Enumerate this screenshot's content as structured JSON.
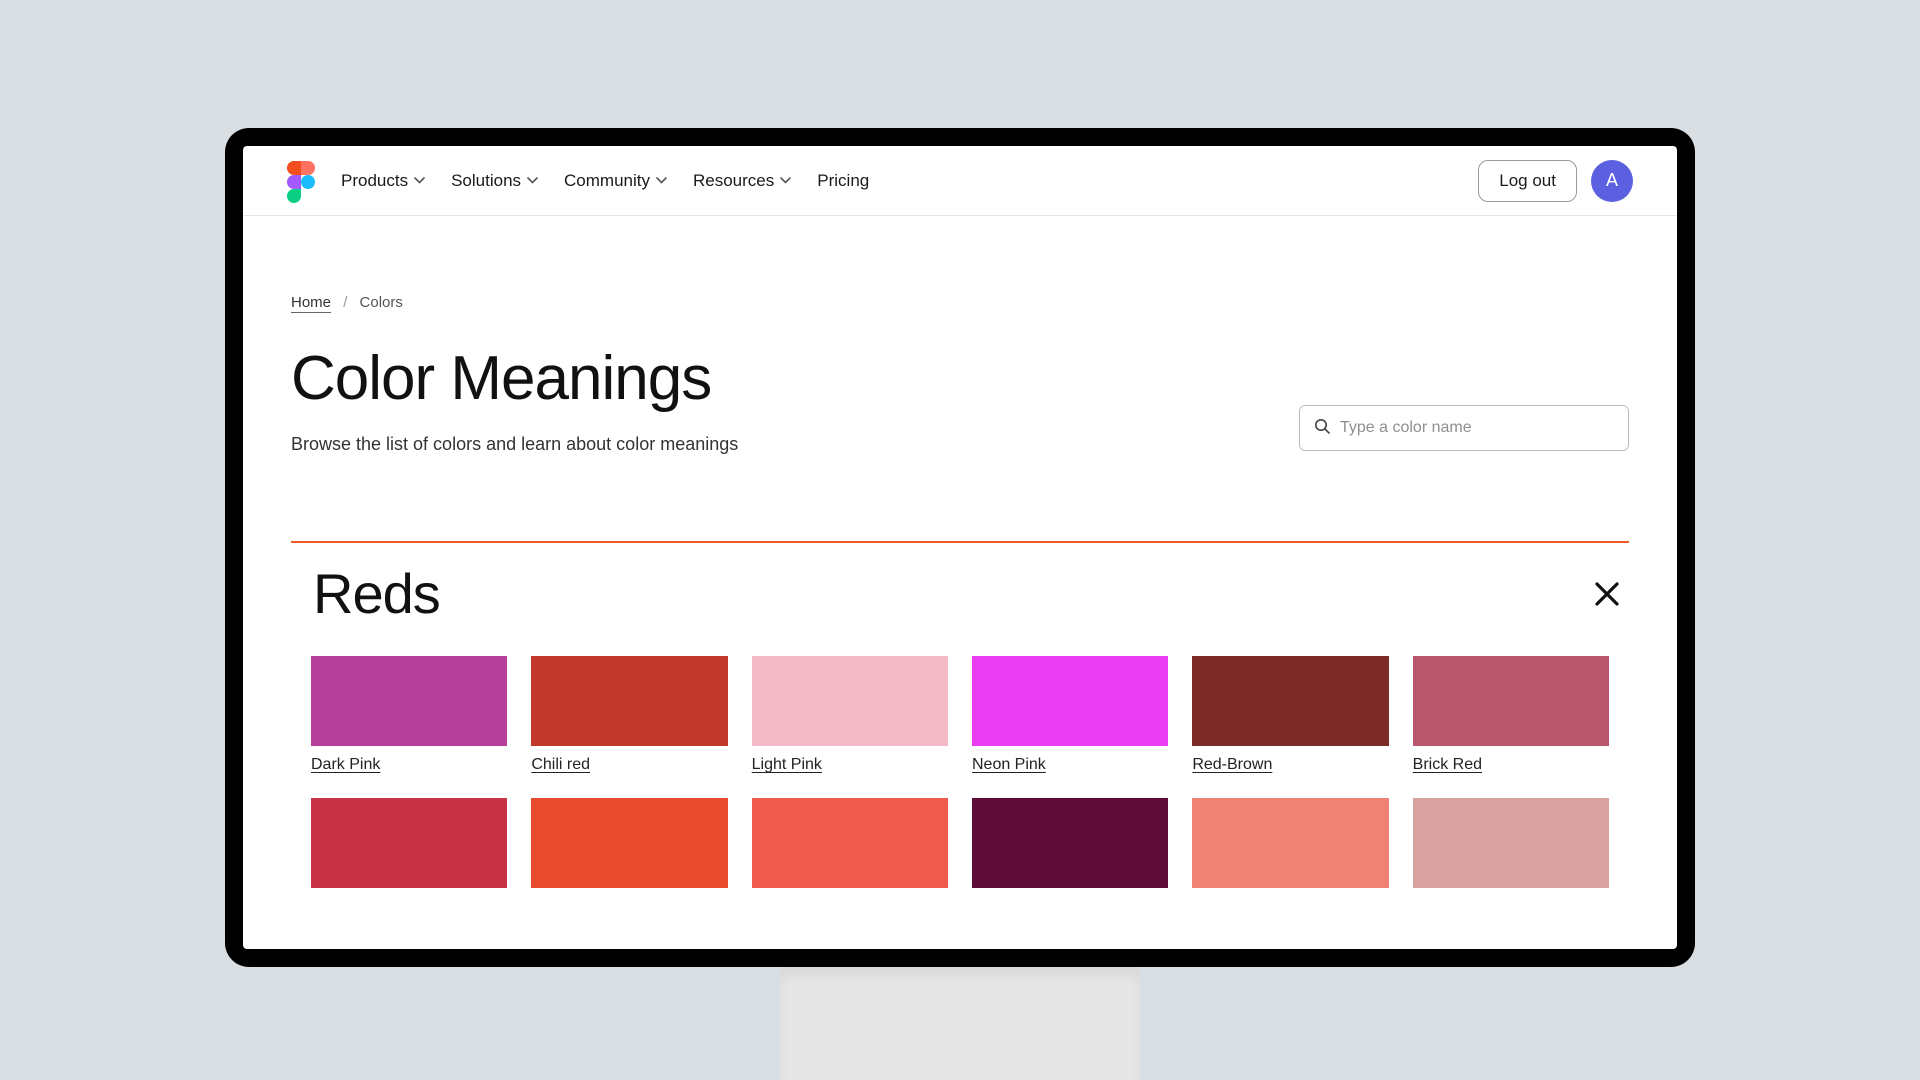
{
  "nav": {
    "items": [
      {
        "label": "Products",
        "has_dropdown": true
      },
      {
        "label": "Solutions",
        "has_dropdown": true
      },
      {
        "label": "Community",
        "has_dropdown": true
      },
      {
        "label": "Resources",
        "has_dropdown": true
      },
      {
        "label": "Pricing",
        "has_dropdown": false
      }
    ],
    "logout_label": "Log out",
    "avatar_initial": "A"
  },
  "breadcrumb": {
    "home_label": "Home",
    "separator": "/",
    "current": "Colors"
  },
  "page": {
    "title": "Color Meanings",
    "subtitle": "Browse the list of colors and learn about color meanings"
  },
  "search": {
    "placeholder": "Type a color name",
    "value": ""
  },
  "section": {
    "title": "Reds",
    "divider_color": "#ea5a2b"
  },
  "swatches_row1": [
    {
      "name": "Dark Pink",
      "hex": "#b73f9c"
    },
    {
      "name": "Chili red",
      "hex": "#c0392b"
    },
    {
      "name": "Light Pink",
      "hex": "#f4b9c6"
    },
    {
      "name": "Neon Pink",
      "hex": "#ea3df2"
    },
    {
      "name": "Red-Brown",
      "hex": "#7d2a27"
    },
    {
      "name": "Brick Red",
      "hex": "#b8576b"
    }
  ],
  "swatches_row2": [
    {
      "hex": "#c73345"
    },
    {
      "hex": "#e74a2d"
    },
    {
      "hex": "#ef5a4e"
    },
    {
      "hex": "#5e0d38"
    },
    {
      "hex": "#ef8273"
    },
    {
      "hex": "#d7a29f"
    }
  ]
}
